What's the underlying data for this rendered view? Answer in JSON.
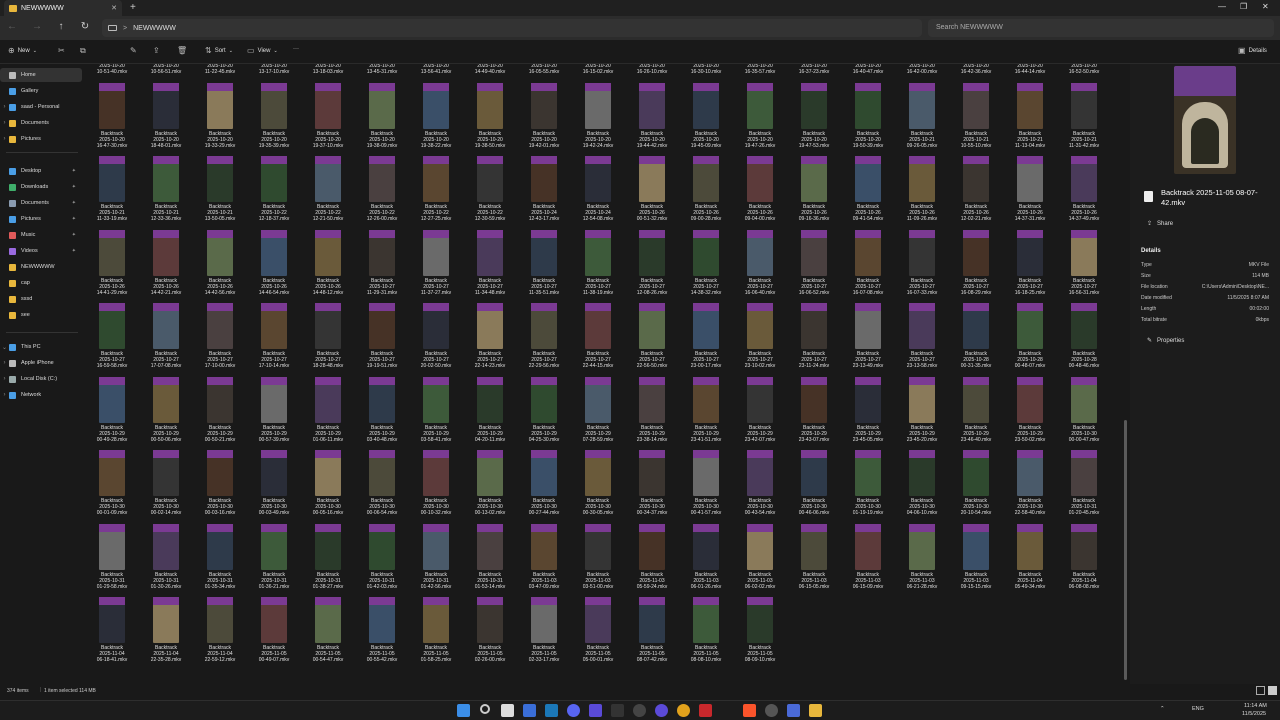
{
  "window": {
    "tab_title": "NEWWWWW",
    "tab_close": "✕",
    "new_tab": "+",
    "min": "—",
    "max": "❐",
    "close": "✕"
  },
  "nav": {
    "back": "←",
    "forward": "→",
    "up": "↑",
    "refresh": "↻",
    "chevron": ">",
    "path": "NEWWWWW",
    "search_placeholder": "Search NEWWWWW"
  },
  "toolbar": {
    "new_label": "New",
    "sort_label": "Sort",
    "view_label": "View",
    "more_label": "···",
    "details_label": "Details"
  },
  "sidebar": {
    "items": [
      {
        "label": "Home",
        "chev": "",
        "icon": "home-icon",
        "color": "#bbb"
      },
      {
        "label": "Gallery",
        "chev": "",
        "icon": "gallery-icon",
        "color": "#4a9ee6"
      },
      {
        "label": "saad - Personal",
        "chev": "›",
        "icon": "cloud-icon",
        "color": "#4a9ee6"
      },
      {
        "label": "Documents",
        "chev": "›",
        "icon": "folder-icon",
        "color": "#e8b73c"
      },
      {
        "label": "Pictures",
        "chev": "›",
        "icon": "folder-icon",
        "color": "#e8b73c"
      },
      {
        "label": "Desktop",
        "chev": "",
        "icon": "desktop-icon",
        "color": "#4a9ee6",
        "pin": "✦"
      },
      {
        "label": "Downloads",
        "chev": "",
        "icon": "download-icon",
        "color": "#3fae6a",
        "pin": "✦"
      },
      {
        "label": "Documents",
        "chev": "",
        "icon": "document-icon",
        "color": "#8a9bb0",
        "pin": "✦"
      },
      {
        "label": "Pictures",
        "chev": "",
        "icon": "pictures-icon",
        "color": "#4a9ee6",
        "pin": "✦"
      },
      {
        "label": "Music",
        "chev": "",
        "icon": "music-icon",
        "color": "#e05a5a",
        "pin": "✦"
      },
      {
        "label": "Videos",
        "chev": "",
        "icon": "videos-icon",
        "color": "#9a6ae0",
        "pin": "✦"
      },
      {
        "label": "NEWWWWW",
        "chev": "",
        "icon": "folder-icon",
        "color": "#e8b73c"
      },
      {
        "label": "cap",
        "chev": "",
        "icon": "folder-icon",
        "color": "#e8b73c"
      },
      {
        "label": "sssd",
        "chev": "",
        "icon": "folder-icon",
        "color": "#e8b73c"
      },
      {
        "label": "see",
        "chev": "",
        "icon": "folder-icon",
        "color": "#e8b73c"
      },
      {
        "label": "This PC",
        "chev": "⌄",
        "icon": "pc-icon",
        "color": "#4a9ee6"
      },
      {
        "label": "Apple iPhone",
        "chev": "›",
        "icon": "phone-icon",
        "color": "#bbb"
      },
      {
        "label": "Local Disk (C:)",
        "chev": "›",
        "icon": "disk-icon",
        "color": "#9aa"
      },
      {
        "label": "Network",
        "chev": "›",
        "icon": "network-icon",
        "color": "#4a9ee6"
      }
    ]
  },
  "files": [
    {
      "a": "Backtrack",
      "d": "2025-10-20",
      "t": "10-51-40.mkv"
    },
    {
      "a": "Backtrack",
      "d": "2025-10-20",
      "t": "10-56-51.mkv"
    },
    {
      "a": "Backtrack",
      "d": "2025-10-20",
      "t": "11-22-45.mkv"
    },
    {
      "a": "Backtrack",
      "d": "2025-10-20",
      "t": "13-17-10.mkv"
    },
    {
      "a": "Backtrack",
      "d": "2025-10-20",
      "t": "13-18-03.mkv"
    },
    {
      "a": "Backtrack",
      "d": "2025-10-20",
      "t": "13-45-31.mkv"
    },
    {
      "a": "Backtrack",
      "d": "2025-10-20",
      "t": "13-56-41.mkv"
    },
    {
      "a": "Backtrack",
      "d": "2025-10-20",
      "t": "14-49-40.mkv"
    },
    {
      "a": "Backtrack",
      "d": "2025-10-20",
      "t": "16-05-55.mkv"
    },
    {
      "a": "Backtrack",
      "d": "2025-10-20",
      "t": "16-15-02.mkv"
    },
    {
      "a": "Backtrack",
      "d": "2025-10-20",
      "t": "16-26-10.mkv"
    },
    {
      "a": "Backtrack",
      "d": "2025-10-20",
      "t": "16-30-10.mkv"
    },
    {
      "a": "Backtrack",
      "d": "2025-10-20",
      "t": "16-35-57.mkv"
    },
    {
      "a": "Backtrack",
      "d": "2025-10-20",
      "t": "16-37-23.mkv"
    },
    {
      "a": "Backtrack",
      "d": "2025-10-20",
      "t": "16-40-47.mkv"
    },
    {
      "a": "Backtrack",
      "d": "2025-10-20",
      "t": "16-42-00.mkv"
    },
    {
      "a": "Backtrack",
      "d": "2025-10-20",
      "t": "16-42-36.mkv"
    },
    {
      "a": "Backtrack",
      "d": "2025-10-20",
      "t": "16-44-14.mkv"
    },
    {
      "a": "Backtrack",
      "d": "2025-10-20",
      "t": "16-52-50.mkv"
    },
    {
      "a": "Backtrack",
      "d": "2025-10-20",
      "t": "16-47-30.mkv"
    },
    {
      "a": "Backtrack",
      "d": "2025-10-20",
      "t": "18-48-01.mkv"
    },
    {
      "a": "Backtrack",
      "d": "2025-10-20",
      "t": "19-33-29.mkv"
    },
    {
      "a": "Backtrack",
      "d": "2025-10-20",
      "t": "19-35-39.mkv"
    },
    {
      "a": "Backtrack",
      "d": "2025-10-20",
      "t": "19-37-10.mkv"
    },
    {
      "a": "Backtrack",
      "d": "2025-10-20",
      "t": "19-38-09.mkv"
    },
    {
      "a": "Backtrack",
      "d": "2025-10-20",
      "t": "19-38-22.mkv"
    },
    {
      "a": "Backtrack",
      "d": "2025-10-20",
      "t": "19-38-50.mkv"
    },
    {
      "a": "Backtrack",
      "d": "2025-10-20",
      "t": "19-42-01.mkv"
    },
    {
      "a": "Backtrack",
      "d": "2025-10-20",
      "t": "19-42-24.mkv"
    },
    {
      "a": "Backtrack",
      "d": "2025-10-20",
      "t": "19-44-42.mkv"
    },
    {
      "a": "Backtrack",
      "d": "2025-10-20",
      "t": "19-45-09.mkv"
    },
    {
      "a": "Backtrack",
      "d": "2025-10-20",
      "t": "19-47-26.mkv"
    },
    {
      "a": "Backtrack",
      "d": "2025-10-20",
      "t": "19-47-53.mkv"
    },
    {
      "a": "Backtrack",
      "d": "2025-10-20",
      "t": "19-50-39.mkv"
    },
    {
      "a": "Backtrack",
      "d": "2025-10-21",
      "t": "09-26-05.mkv"
    },
    {
      "a": "Backtrack",
      "d": "2025-10-21",
      "t": "10-55-10.mkv"
    },
    {
      "a": "Backtrack",
      "d": "2025-10-21",
      "t": "11-13-04.mkv"
    },
    {
      "a": "Backtrack",
      "d": "2025-10-21",
      "t": "11-31-42.mkv"
    },
    {
      "a": "Backtrack",
      "d": "2025-10-21",
      "t": "11-33-19.mkv"
    },
    {
      "a": "Backtrack",
      "d": "2025-10-21",
      "t": "12-33-36.mkv"
    },
    {
      "a": "Backtrack",
      "d": "2025-10-21",
      "t": "13-50-05.mkv"
    },
    {
      "a": "Backtrack",
      "d": "2025-10-22",
      "t": "12-18-37.mkv"
    },
    {
      "a": "Backtrack",
      "d": "2025-10-22",
      "t": "12-21-50.mkv"
    },
    {
      "a": "Backtrack",
      "d": "2025-10-22",
      "t": "12-26-00.mkv"
    },
    {
      "a": "Backtrack",
      "d": "2025-10-22",
      "t": "12-27-25.mkv"
    },
    {
      "a": "Backtrack",
      "d": "2025-10-22",
      "t": "12-30-59.mkv"
    },
    {
      "a": "Backtrack",
      "d": "2025-10-24",
      "t": "12-43-17.mkv"
    },
    {
      "a": "Backtrack",
      "d": "2025-10-24",
      "t": "12-54-08.mkv"
    },
    {
      "a": "Backtrack",
      "d": "2025-10-26",
      "t": "00-51-32.mkv"
    },
    {
      "a": "Backtrack",
      "d": "2025-10-26",
      "t": "09-00-28.mkv"
    },
    {
      "a": "Backtrack",
      "d": "2025-10-26",
      "t": "09-04-00.mkv"
    },
    {
      "a": "Backtrack",
      "d": "2025-10-26",
      "t": "09-16-36.mkv"
    },
    {
      "a": "Backtrack",
      "d": "2025-10-26",
      "t": "09-41-54.mkv"
    },
    {
      "a": "Backtrack",
      "d": "2025-10-26",
      "t": "11-09-26.mkv"
    },
    {
      "a": "Backtrack",
      "d": "2025-10-26",
      "t": "12-02-21.mkv"
    },
    {
      "a": "Backtrack",
      "d": "2025-10-26",
      "t": "14-37-31.mkv"
    },
    {
      "a": "Backtrack",
      "d": "2025-10-26",
      "t": "14-37-49.mkv"
    },
    {
      "a": "Backtrack",
      "d": "2025-10-26",
      "t": "14-41-29.mkv"
    },
    {
      "a": "Backtrack",
      "d": "2025-10-26",
      "t": "14-42-21.mkv"
    },
    {
      "a": "Backtrack",
      "d": "2025-10-26",
      "t": "14-42-56.mkv"
    },
    {
      "a": "Backtrack",
      "d": "2025-10-26",
      "t": "14-46-54.mkv"
    },
    {
      "a": "Backtrack",
      "d": "2025-10-26",
      "t": "14-48-12.mkv"
    },
    {
      "a": "Backtrack",
      "d": "2025-10-27",
      "t": "11-29-31.mkv"
    },
    {
      "a": "Backtrack",
      "d": "2025-10-27",
      "t": "11-37-27.mkv"
    },
    {
      "a": "Backtrack",
      "d": "2025-10-27",
      "t": "11-34-48.mkv"
    },
    {
      "a": "Backtrack",
      "d": "2025-10-27",
      "t": "11-35-51.mkv"
    },
    {
      "a": "Backtrack",
      "d": "2025-10-27",
      "t": "11-38-19.mkv"
    },
    {
      "a": "Backtrack",
      "d": "2025-10-27",
      "t": "12-08-26.mkv"
    },
    {
      "a": "Backtrack",
      "d": "2025-10-27",
      "t": "14-38-32.mkv"
    },
    {
      "a": "Backtrack",
      "d": "2025-10-27",
      "t": "16-06-40.mkv"
    },
    {
      "a": "Backtrack",
      "d": "2025-10-27",
      "t": "16-06-52.mkv"
    },
    {
      "a": "Backtrack",
      "d": "2025-10-27",
      "t": "16-07-08.mkv"
    },
    {
      "a": "Backtrack",
      "d": "2025-10-27",
      "t": "16-07-33.mkv"
    },
    {
      "a": "Backtrack",
      "d": "2025-10-27",
      "t": "16-08-29.mkv"
    },
    {
      "a": "Backtrack",
      "d": "2025-10-27",
      "t": "16-18-25.mkv"
    },
    {
      "a": "Backtrack",
      "d": "2025-10-27",
      "t": "16-56-31.mkv"
    },
    {
      "a": "Backtrack",
      "d": "2025-10-27",
      "t": "16-59-58.mkv"
    },
    {
      "a": "Backtrack",
      "d": "2025-10-27",
      "t": "17-07-08.mkv"
    },
    {
      "a": "Backtrack",
      "d": "2025-10-27",
      "t": "17-10-00.mkv"
    },
    {
      "a": "Backtrack",
      "d": "2025-10-27",
      "t": "17-10-14.mkv"
    },
    {
      "a": "Backtrack",
      "d": "2025-10-27",
      "t": "18-28-48.mkv"
    },
    {
      "a": "Backtrack",
      "d": "2025-10-27",
      "t": "19-19-51.mkv"
    },
    {
      "a": "Backtrack",
      "d": "2025-10-27",
      "t": "20-02-50.mkv"
    },
    {
      "a": "Backtrack",
      "d": "2025-10-27",
      "t": "22-14-23.mkv"
    },
    {
      "a": "Backtrack",
      "d": "2025-10-27",
      "t": "22-29-56.mkv"
    },
    {
      "a": "Backtrack",
      "d": "2025-10-27",
      "t": "22-44-15.mkv"
    },
    {
      "a": "Backtrack",
      "d": "2025-10-27",
      "t": "22-56-50.mkv"
    },
    {
      "a": "Backtrack",
      "d": "2025-10-27",
      "t": "23-00-17.mkv"
    },
    {
      "a": "Backtrack",
      "d": "2025-10-27",
      "t": "23-10-02.mkv"
    },
    {
      "a": "Backtrack",
      "d": "2025-10-27",
      "t": "23-11-24.mkv"
    },
    {
      "a": "Backtrack",
      "d": "2025-10-27",
      "t": "23-13-49.mkv"
    },
    {
      "a": "Backtrack",
      "d": "2025-10-27",
      "t": "23-13-58.mkv"
    },
    {
      "a": "Backtrack",
      "d": "2025-10-28",
      "t": "00-31-35.mkv"
    },
    {
      "a": "Backtrack",
      "d": "2025-10-28",
      "t": "00-48-07.mkv"
    },
    {
      "a": "Backtrack",
      "d": "2025-10-28",
      "t": "00-48-46.mkv"
    },
    {
      "a": "Backtrack",
      "d": "2025-10-29",
      "t": "00-49-28.mkv"
    },
    {
      "a": "Backtrack",
      "d": "2025-10-29",
      "t": "00-50-06.mkv"
    },
    {
      "a": "Backtrack",
      "d": "2025-10-29",
      "t": "00-50-21.mkv"
    },
    {
      "a": "Backtrack",
      "d": "2025-10-29",
      "t": "00-57-39.mkv"
    },
    {
      "a": "Backtrack",
      "d": "2025-10-29",
      "t": "01-06-11.mkv"
    },
    {
      "a": "Backtrack",
      "d": "2025-10-29",
      "t": "03-40-48.mkv"
    },
    {
      "a": "Backtrack",
      "d": "2025-10-29",
      "t": "03-58-41.mkv"
    },
    {
      "a": "Backtrack",
      "d": "2025-10-29",
      "t": "04-20-11.mkv"
    },
    {
      "a": "Backtrack",
      "d": "2025-10-29",
      "t": "04-25-30.mkv"
    },
    {
      "a": "Backtrack",
      "d": "2025-10-29",
      "t": "07-28-59.mkv"
    },
    {
      "a": "Backtrack",
      "d": "2025-10-29",
      "t": "23-38-14.mkv"
    },
    {
      "a": "Backtrack",
      "d": "2025-10-29",
      "t": "23-41-51.mkv"
    },
    {
      "a": "Backtrack",
      "d": "2025-10-29",
      "t": "23-42-07.mkv"
    },
    {
      "a": "Backtrack",
      "d": "2025-10-29",
      "t": "23-43-07.mkv"
    },
    {
      "a": "Backtrack",
      "d": "2025-10-29",
      "t": "23-45-05.mkv"
    },
    {
      "a": "Backtrack",
      "d": "2025-10-29",
      "t": "23-45-20.mkv"
    },
    {
      "a": "Backtrack",
      "d": "2025-10-29",
      "t": "23-46-40.mkv"
    },
    {
      "a": "Backtrack",
      "d": "2025-10-29",
      "t": "23-50-02.mkv"
    },
    {
      "a": "Backtrack",
      "d": "2025-10-30",
      "t": "00-00-47.mkv"
    },
    {
      "a": "Backtrack",
      "d": "2025-10-30",
      "t": "00-01-09.mkv"
    },
    {
      "a": "Backtrack",
      "d": "2025-10-30",
      "t": "00-02-14.mkv"
    },
    {
      "a": "Backtrack",
      "d": "2025-10-30",
      "t": "00-03-16.mkv"
    },
    {
      "a": "Backtrack",
      "d": "2025-10-30",
      "t": "00-03-49.mkv"
    },
    {
      "a": "Backtrack",
      "d": "2025-10-30",
      "t": "00-05-16.mkv"
    },
    {
      "a": "Backtrack",
      "d": "2025-10-30",
      "t": "00-06-54.mkv"
    },
    {
      "a": "Backtrack",
      "d": "2025-10-30",
      "t": "00-10-32.mkv"
    },
    {
      "a": "Backtrack",
      "d": "2025-10-30",
      "t": "00-13-02.mkv"
    },
    {
      "a": "Backtrack",
      "d": "2025-10-30",
      "t": "00-27-44.mkv"
    },
    {
      "a": "Backtrack",
      "d": "2025-10-30",
      "t": "00-30-05.mkv"
    },
    {
      "a": "Backtrack",
      "d": "2025-10-30",
      "t": "00-34-37.mkv"
    },
    {
      "a": "Backtrack",
      "d": "2025-10-30",
      "t": "00-41-57.mkv"
    },
    {
      "a": "Backtrack",
      "d": "2025-10-30",
      "t": "00-43-54.mkv"
    },
    {
      "a": "Backtrack",
      "d": "2025-10-30",
      "t": "00-46-06.mkv"
    },
    {
      "a": "Backtrack",
      "d": "2025-10-30",
      "t": "01-19-19.mkv"
    },
    {
      "a": "Backtrack",
      "d": "2025-10-30",
      "t": "04-06-10.mkv"
    },
    {
      "a": "Backtrack",
      "d": "2025-10-30",
      "t": "20-10-54.mkv"
    },
    {
      "a": "Backtrack",
      "d": "2025-10-30",
      "t": "22-58-40.mkv"
    },
    {
      "a": "Backtrack",
      "d": "2025-10-31",
      "t": "01-20-45.mkv"
    },
    {
      "a": "Backtrack",
      "d": "2025-10-31",
      "t": "01-29-58.mkv"
    },
    {
      "a": "Backtrack",
      "d": "2025-10-31",
      "t": "01-30-26.mkv"
    },
    {
      "a": "Backtrack",
      "d": "2025-10-31",
      "t": "01-35-34.mkv"
    },
    {
      "a": "Backtrack",
      "d": "2025-10-31",
      "t": "01-36-21.mkv"
    },
    {
      "a": "Backtrack",
      "d": "2025-10-31",
      "t": "01-38-27.mkv"
    },
    {
      "a": "Backtrack",
      "d": "2025-10-31",
      "t": "01-42-03.mkv"
    },
    {
      "a": "Backtrack",
      "d": "2025-10-31",
      "t": "01-42-56.mkv"
    },
    {
      "a": "Backtrack",
      "d": "2025-10-31",
      "t": "01-53-14.mkv"
    },
    {
      "a": "Backtrack",
      "d": "2025-11-03",
      "t": "03-47-09.mkv"
    },
    {
      "a": "Backtrack",
      "d": "2025-11-03",
      "t": "03-51-00.mkv"
    },
    {
      "a": "Backtrack",
      "d": "2025-11-03",
      "t": "05-59-24.mkv"
    },
    {
      "a": "Backtrack",
      "d": "2025-11-03",
      "t": "06-01-26.mkv"
    },
    {
      "a": "Backtrack",
      "d": "2025-11-03",
      "t": "06-02-02.mkv"
    },
    {
      "a": "Backtrack",
      "d": "2025-11-03",
      "t": "06-15-05.mkv"
    },
    {
      "a": "Backtrack",
      "d": "2025-11-03",
      "t": "06-15-09.mkv"
    },
    {
      "a": "Backtrack",
      "d": "2025-11-03",
      "t": "06-21-28.mkv"
    },
    {
      "a": "Backtrack",
      "d": "2025-11-03",
      "t": "09-15-15.mkv"
    },
    {
      "a": "Backtrack",
      "d": "2025-11-04",
      "t": "05-49-34.mkv"
    },
    {
      "a": "Backtrack",
      "d": "2025-11-04",
      "t": "06-08-08.mkv"
    },
    {
      "a": "Backtrack",
      "d": "2025-11-04",
      "t": "06-18-41.mkv"
    },
    {
      "a": "Backtrack",
      "d": "2025-11-04",
      "t": "22-35-28.mkv"
    },
    {
      "a": "Backtrack",
      "d": "2025-11-04",
      "t": "22-59-12.mkv"
    },
    {
      "a": "Backtrack",
      "d": "2025-11-05",
      "t": "00-49-07.mkv"
    },
    {
      "a": "Backtrack",
      "d": "2025-11-05",
      "t": "00-54-47.mkv"
    },
    {
      "a": "Backtrack",
      "d": "2025-11-05",
      "t": "00-55-42.mkv"
    },
    {
      "a": "Backtrack",
      "d": "2025-11-05",
      "t": "01-58-25.mkv"
    },
    {
      "a": "Backtrack",
      "d": "2025-11-05",
      "t": "02-26-00.mkv"
    },
    {
      "a": "Backtrack",
      "d": "2025-11-05",
      "t": "02-33-17.mkv"
    },
    {
      "a": "Backtrack",
      "d": "2025-11-05",
      "t": "05-00-01.mkv"
    },
    {
      "a": "Backtrack",
      "d": "2025-11-05",
      "t": "08-07-42.mkv"
    },
    {
      "a": "Backtrack",
      "d": "2025-11-05",
      "t": "08-08-10.mkv"
    },
    {
      "a": "Backtrack",
      "d": "2025-11-05",
      "t": "08-09-10.mkv"
    }
  ],
  "thumb_colors": [
    "#3b3530",
    "#463226",
    "#2e3a4a",
    "#4c4a3a",
    "#2f4a2f",
    "#3a4f68",
    "#5a4630",
    "#6a6a6a",
    "#2a2d38",
    "#3d5a3a",
    "#5c3a3a",
    "#4a5a6a",
    "#6a5a3a",
    "#343434",
    "#4a3a5a",
    "#8a7a5a",
    "#2a3a2a",
    "#5a6a4a",
    "#4a4040"
  ],
  "selected_index": 182,
  "details": {
    "title": "Backtrack 2025-11-05 08-07-42.mkv",
    "share_label": "Share",
    "section_label": "Details",
    "properties_label": "Properties",
    "rows": [
      {
        "k": "Type",
        "v": "MKV File"
      },
      {
        "k": "Size",
        "v": "114 MB"
      },
      {
        "k": "File location",
        "v": "C:\\Users\\Admin\\Desktop\\NE..."
      },
      {
        "k": "Date modified",
        "v": "11/5/2025 8:07 AM"
      },
      {
        "k": "Length",
        "v": "00:02:00"
      },
      {
        "k": "Total bitrate",
        "v": "0kbps"
      }
    ]
  },
  "status": {
    "items": "374 items",
    "selection": "1 item selected  114 MB"
  },
  "taskbar": {
    "lang": "ENG",
    "time": "11:14 AM",
    "date": "11/5/2025",
    "chevron": "⌃"
  }
}
